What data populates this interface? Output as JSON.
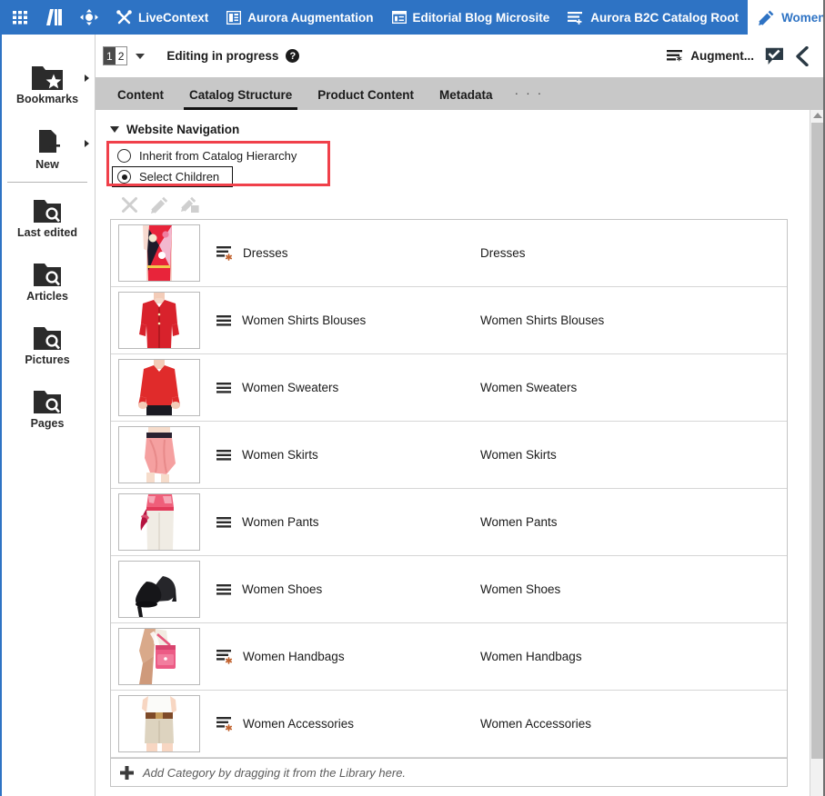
{
  "topbar": {
    "items": [
      {
        "label": "",
        "icon": "apps-grid-icon",
        "name": "apps-grid-button"
      },
      {
        "label": "",
        "icon": "library-icon",
        "name": "library-button"
      },
      {
        "label": "",
        "icon": "preview-target-icon",
        "name": "preview-target-button"
      },
      {
        "label": "LiveContext",
        "icon": "tools-icon",
        "name": "livecontext-button"
      },
      {
        "label": "Aurora Augmentation",
        "icon": "page-layout-icon",
        "name": "aurora-augmentation-button"
      },
      {
        "label": "Editorial Blog Microsite",
        "icon": "microsite-icon",
        "name": "editorial-blog-microsite-button"
      },
      {
        "label": "Aurora B2C Catalog Root",
        "icon": "catalog-root-icon",
        "name": "aurora-b2c-catalog-root-button"
      }
    ],
    "active_tab": {
      "label": "Women",
      "icon": "pencil-icon"
    },
    "bg_color": "#2e73c4"
  },
  "subbar": {
    "version_current": "1",
    "version_total": "2",
    "status": "Editing in progress",
    "help": "?",
    "augment_label": "Augment...",
    "comment_icon": "comment-check-icon",
    "back_icon": "chevron-left-icon"
  },
  "tabs": {
    "items": [
      {
        "label": "Content",
        "active": false
      },
      {
        "label": "Catalog Structure",
        "active": true
      },
      {
        "label": "Product Content",
        "active": false
      },
      {
        "label": "Metadata",
        "active": false
      }
    ],
    "more": "· · ·"
  },
  "sidebar": {
    "items": [
      {
        "label": "Bookmarks",
        "icon": "folder-star-icon",
        "has_arrow": true
      },
      {
        "label": "New",
        "icon": "new-page-icon",
        "has_arrow": true
      },
      {
        "label": "Last edited",
        "icon": "folder-search-icon",
        "has_arrow": false
      },
      {
        "label": "Articles",
        "icon": "folder-search-icon",
        "has_arrow": false
      },
      {
        "label": "Pictures",
        "icon": "folder-search-icon",
        "has_arrow": false
      },
      {
        "label": "Pages",
        "icon": "folder-search-icon",
        "has_arrow": false
      }
    ]
  },
  "panel": {
    "title": "Website Navigation",
    "radio_options": [
      {
        "label": "Inherit from Catalog Hierarchy",
        "checked": false,
        "focused": false
      },
      {
        "label": "Select Children",
        "checked": true,
        "focused": true
      }
    ],
    "highlight_color": "#f0404a",
    "tools": [
      {
        "name": "remove-icon",
        "enabled": false
      },
      {
        "name": "edit-icon",
        "enabled": false
      },
      {
        "name": "edit-in-tab-icon",
        "enabled": false
      }
    ],
    "add_row_label": "Add Category by dragging it from the Library here.",
    "add_row_icon": "plus-icon"
  },
  "rows": [
    {
      "name": "Dresses",
      "name2": "Dresses",
      "icon": "category-augmented-icon",
      "thumb": "dress-multicolor"
    },
    {
      "name": "Women Shirts Blouses",
      "name2": "Women Shirts Blouses",
      "icon": "category-icon",
      "thumb": "red-blouse"
    },
    {
      "name": "Women Sweaters",
      "name2": "Women Sweaters",
      "icon": "category-icon",
      "thumb": "red-sweater"
    },
    {
      "name": "Women Skirts",
      "name2": "Women Skirts",
      "icon": "category-icon",
      "thumb": "pink-skirt"
    },
    {
      "name": "Women Pants",
      "name2": "Women Pants",
      "icon": "category-icon",
      "thumb": "white-pants"
    },
    {
      "name": "Women Shoes",
      "name2": "Women Shoes",
      "icon": "category-icon",
      "thumb": "black-heels"
    },
    {
      "name": "Women Handbags",
      "name2": "Women Handbags",
      "icon": "category-augmented-icon",
      "thumb": "pink-handbag"
    },
    {
      "name": "Women Accessories",
      "name2": "Women Accessories",
      "icon": "category-augmented-icon",
      "thumb": "khaki-shorts"
    }
  ]
}
